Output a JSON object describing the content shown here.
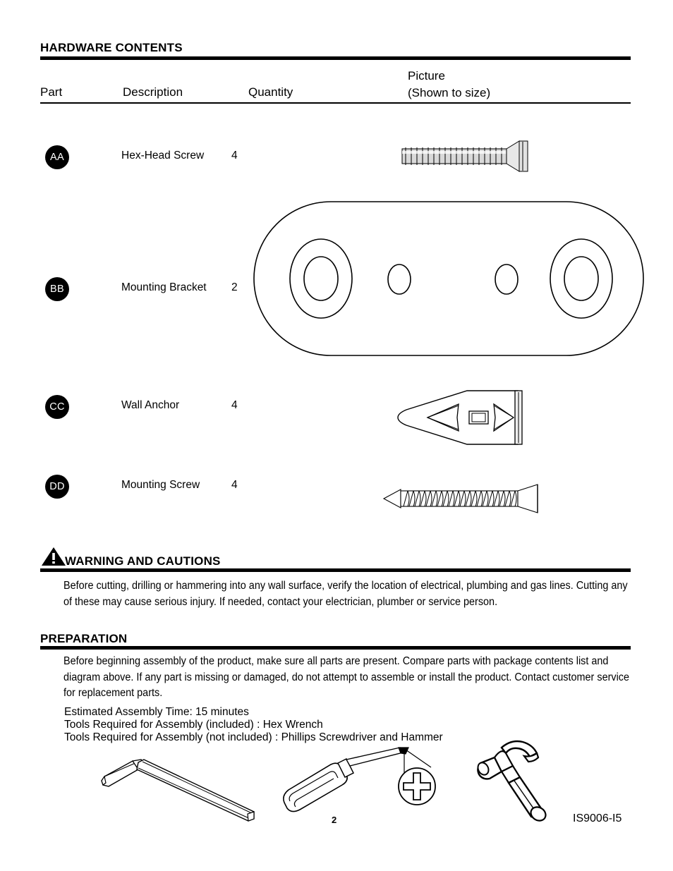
{
  "hardware": {
    "heading": "HARDWARE CONTENTS",
    "columns": {
      "part": "Part",
      "description": "Description",
      "quantity": "Quantity",
      "picture_line1": "Picture",
      "picture_line2": "(Shown to size)"
    },
    "rows": [
      {
        "code": "AA",
        "description": "Hex-Head Screw",
        "quantity": "4",
        "picture_icon": "hex-head-screw-icon"
      },
      {
        "code": "BB",
        "description": "Mounting Bracket",
        "quantity": "2",
        "picture_icon": "mounting-bracket-icon"
      },
      {
        "code": "CC",
        "description": "Wall Anchor",
        "quantity": "4",
        "picture_icon": "wall-anchor-icon"
      },
      {
        "code": "DD",
        "description": "Mounting Screw",
        "quantity": "4",
        "picture_icon": "mounting-screw-icon"
      }
    ]
  },
  "warning": {
    "heading": "WARNING AND CAUTIONS",
    "icon": "warning-triangle-icon",
    "body": "Before cutting, drilling or hammering into any wall surface, verify the location of electrical, plumbing and gas lines. Cutting any of these may cause serious injury. If needed, contact your electrician, plumber or service person."
  },
  "preparation": {
    "heading": "PREPARATION",
    "body": "Before beginning assembly of the product, make sure all parts are present. Compare parts with package contents list and diagram above. If any part is missing or damaged, do not attempt to assemble or install the product. Contact customer service for replacement parts.",
    "assembly_time": "Estimated Assembly Time: 15 minutes",
    "tools_included": "Tools Required for Assembly (included) : Hex Wrench",
    "tools_not_included": "Tools Required for Assembly (not included) : Phillips Screwdriver and Hammer",
    "tool_icons": [
      "hex-wrench-icon",
      "phillips-screwdriver-icon",
      "hammer-icon"
    ]
  },
  "footer": {
    "page_number": "2",
    "document_code": "IS9006-I5"
  },
  "colors": {
    "ink": "#000000",
    "paper": "#ffffff",
    "badge_fill": "#000000",
    "badge_text": "#ffffff"
  }
}
